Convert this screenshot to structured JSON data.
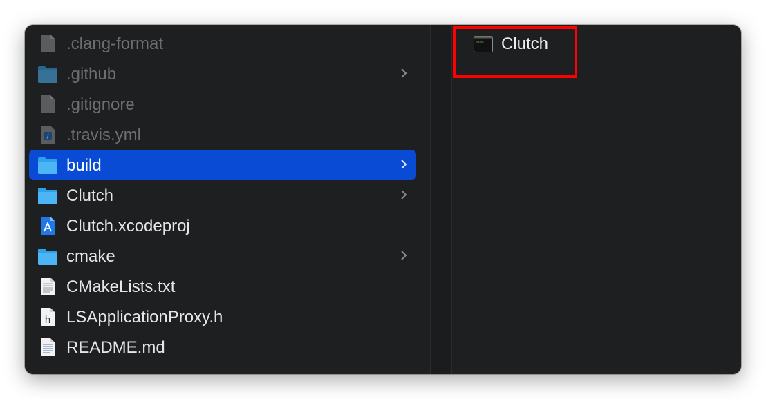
{
  "column1": {
    "items": [
      {
        "name": ".clang-format",
        "kind": "file-generic",
        "dim": true,
        "has_children": false
      },
      {
        "name": ".github",
        "kind": "folder",
        "dim": true,
        "has_children": true
      },
      {
        "name": ".gitignore",
        "kind": "file-generic",
        "dim": true,
        "has_children": false
      },
      {
        "name": ".travis.yml",
        "kind": "file-yml",
        "dim": true,
        "has_children": false
      },
      {
        "name": "build",
        "kind": "folder",
        "dim": false,
        "has_children": true,
        "selected": true
      },
      {
        "name": "Clutch",
        "kind": "folder",
        "dim": false,
        "has_children": true
      },
      {
        "name": "Clutch.xcodeproj",
        "kind": "xcodeproj",
        "dim": false,
        "has_children": false
      },
      {
        "name": "cmake",
        "kind": "folder",
        "dim": false,
        "has_children": true
      },
      {
        "name": "CMakeLists.txt",
        "kind": "text-file",
        "dim": false,
        "has_children": false
      },
      {
        "name": "LSApplicationProxy.h",
        "kind": "header-file",
        "dim": false,
        "has_children": false
      },
      {
        "name": "README.md",
        "kind": "text-file",
        "dim": false,
        "has_children": false
      }
    ]
  },
  "column2": {
    "items": [
      {
        "name": "Clutch",
        "kind": "terminal-executable"
      }
    ]
  },
  "colors": {
    "window_bg": "#1e1f20",
    "selection": "#0a4bd6",
    "highlight_box": "#ff0000",
    "folder": "#2fa1e8"
  }
}
